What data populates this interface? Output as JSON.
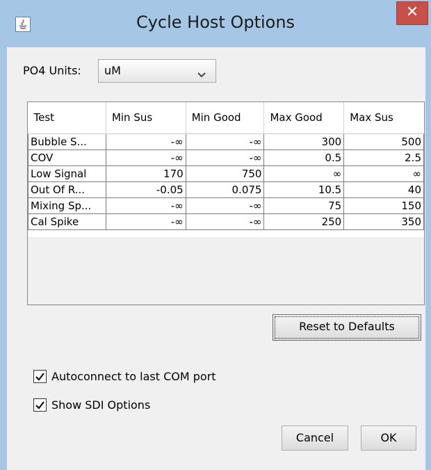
{
  "window": {
    "title": "Cycle Host Options",
    "close_label": "✕"
  },
  "units": {
    "label": "PO4 Units:",
    "selected": "uM"
  },
  "table": {
    "columns": [
      "Test",
      "Min Sus",
      "Min Good",
      "Max Good",
      "Max Sus"
    ],
    "rows": [
      [
        "Bubble S...",
        "-∞",
        "-∞",
        "300",
        "500"
      ],
      [
        "COV",
        "-∞",
        "-∞",
        "0.5",
        "2.5"
      ],
      [
        "Low Signal",
        "170",
        "750",
        "∞",
        "∞"
      ],
      [
        "Out Of R...",
        "-0.05",
        "0.075",
        "10.5",
        "40"
      ],
      [
        "Mixing Sp...",
        "-∞",
        "-∞",
        "75",
        "150"
      ],
      [
        "Cal Spike",
        "-∞",
        "-∞",
        "250",
        "350"
      ]
    ]
  },
  "reset_button": "Reset to Defaults",
  "options": {
    "autoconnect": {
      "label": "Autoconnect to last COM port",
      "checked": true
    },
    "show_sdi": {
      "label": "Show SDI Options",
      "checked": true
    }
  },
  "buttons": {
    "cancel": "Cancel",
    "ok": "OK"
  }
}
